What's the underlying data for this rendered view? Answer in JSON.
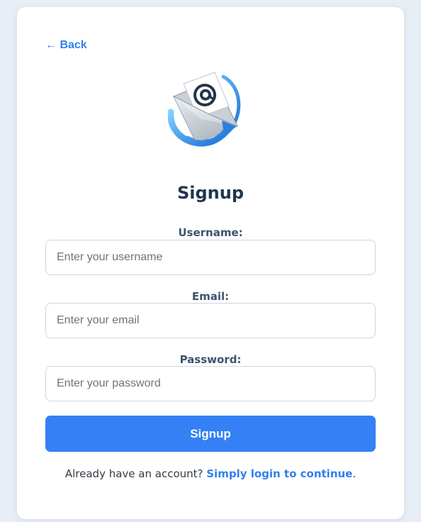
{
  "nav": {
    "back_label": "← Back"
  },
  "logo": {
    "icon": "email-envelope-icon"
  },
  "form": {
    "title": "Signup",
    "username": {
      "label": "Username:",
      "placeholder": "Enter your username",
      "value": ""
    },
    "email": {
      "label": "Email:",
      "placeholder": "Enter your email",
      "value": ""
    },
    "password": {
      "label": "Password:",
      "placeholder": "Enter your password",
      "value": ""
    },
    "submit_label": "Signup"
  },
  "footer": {
    "prompt": "Already have an account? ",
    "link_label": "Simply login to continue",
    "suffix": "."
  },
  "colors": {
    "accent": "#3480f4",
    "link": "#2f7ff0",
    "title": "#1f3650",
    "page_background": "#e8eef6"
  }
}
